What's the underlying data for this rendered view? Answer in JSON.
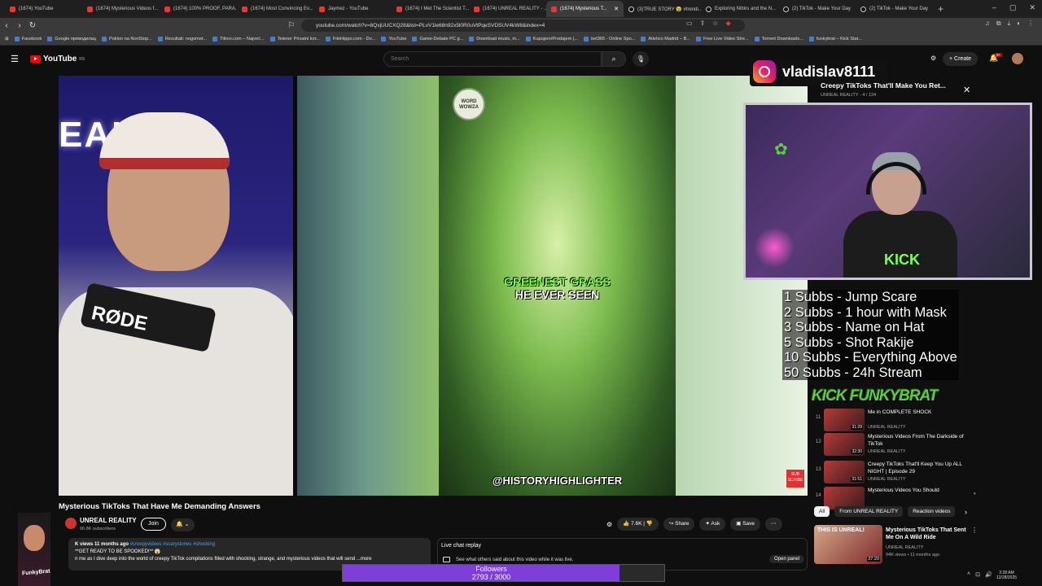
{
  "browser": {
    "tabs": [
      {
        "label": "(1674) YouTube",
        "type": "yt"
      },
      {
        "label": "(1674) Mysterious Videos f...",
        "type": "yt"
      },
      {
        "label": "(1674) 100% PROOF, PARA...",
        "type": "yt"
      },
      {
        "label": "(1674) Most Convincing Ev...",
        "type": "yt"
      },
      {
        "label": "Jaymez - YouTube",
        "type": "yt"
      },
      {
        "label": "(1674) I Met The Scientist T...",
        "type": "yt"
      },
      {
        "label": "(1674) UNREAL REALITY - ...",
        "type": "yt"
      },
      {
        "label": "(1674) Mysterious T...",
        "type": "yt",
        "active": true
      },
      {
        "label": "(3)TRUE STORY 😵 #trendi...",
        "type": "tk"
      },
      {
        "label": "Exploring Nibiru and the N...",
        "type": "tk"
      },
      {
        "label": "(2) TikTok - Make Your Day",
        "type": "tk"
      },
      {
        "label": "(2) TikTok - Make Your Day",
        "type": "tk"
      }
    ],
    "url": "youtube.com/watch?v=8QxjUUCXQ28&list=PLvV1le68n92x5l0R0uVtPqeSVDSUV4kW8&index=4",
    "bookmarks": [
      "Facebook",
      "Google преводилац",
      "Poklon na NonStop...",
      "Rezultati: nogomet...",
      "Titlovi.com – Najveć...",
      "Telenor Privatni kor...",
      "FileHippo.com - Do...",
      "YouTube",
      "Game-Debate PC g...",
      "Download music, m...",
      "Kupujem/Prodajem |...",
      "bet365 - Online Spo...",
      "Atletico Madrid – B...",
      "Free Live Video Stre...",
      "Torrent Downloads...",
      "funkybrat – Kick Stat..."
    ]
  },
  "youtube": {
    "logo_text": "YouTube",
    "logo_region": "RS",
    "search_placeholder": "Search",
    "create_label": "Create",
    "notif_count": "9+"
  },
  "player": {
    "neon_text": "EAL  TY",
    "mic_brand": "RØDE",
    "watermark": "WORD WOWZA",
    "caption_line1": "GREENEST GRASS",
    "caption_line2": "HE EVER SEEN",
    "credit": "@HISTORYHIGHLIGHTER",
    "sub_badge": "SUB SCRIBE"
  },
  "overlay": {
    "instagram_handle": "vladislav8111",
    "miniplayer_title": "Creepy TikToks That'll Make You Ret...",
    "miniplayer_sub": "UNREAL REALITY - 4 / 134",
    "webcam_shirt_text": "KICK",
    "sub_goals": [
      "1 Subbs - Jump Scare",
      "2 Subbs - 1 hour with Mask",
      "3 Subbs - Name on Hat",
      "5 Subbs - Shot Rakije",
      "10 Subbs - Everything Above",
      "50 Subbs - 24h Stream"
    ],
    "kick_logo": "KICK FUNKYBRAT",
    "followers_label": "Followers",
    "followers_value": "2793 / 3000",
    "followers_progress": 0.931,
    "left_book_title": "FunkyBrat"
  },
  "playlist": [
    {
      "index": "11",
      "title": "Me in COMPLETE SHOCK",
      "channel": "UNREAL REALITY",
      "duration": "31:29"
    },
    {
      "index": "12",
      "title": "Mysterious Videos From The Darkside of TikTok",
      "channel": "UNREAL REALITY",
      "duration": "32:30"
    },
    {
      "index": "13",
      "title": "Creepy TikToks That'll Keep You Up ALL NIGHT | Episode 29",
      "channel": "UNREAL REALITY",
      "duration": "31:51"
    },
    {
      "index": "14",
      "title": "Mysterious Videos You Should",
      "channel": "",
      "duration": ""
    }
  ],
  "chips": [
    "All",
    "From UNREAL REALITY",
    "Reaction videos"
  ],
  "recommendation": {
    "title": "Mysterious TikToks That Sent Me On A Wild Ride",
    "channel": "UNREAL REALITY",
    "meta": "94K views • 11 months ago",
    "duration": "37:20",
    "thumb_text": "THIS IS UNREAL!"
  },
  "video": {
    "title": "Mysterious TikToks That Have Me Demanding Answers",
    "channel": "UNREAL REALITY",
    "subscribers": "90.8K subscribers",
    "join_label": "Join",
    "likes": "7.6K",
    "share_label": "Share",
    "ask_label": "Ask",
    "save_label": "Save",
    "desc_views": "K views  11 months ago",
    "desc_tags": "#creepyvideos #scarystories #shocking",
    "desc_line2": "**GET READY TO BE SPOOKED!** 😱",
    "desc_line3": "n me as I dive deep into the world of creepy TikTok compilations filled with shocking, strange, and mysterious videos that will send ...more"
  },
  "live_chat": {
    "title": "Live chat replay",
    "desc": "See what others said about this video while it was live.",
    "open_label": "Open panel"
  },
  "system": {
    "time": "2:28 AM",
    "date": "12/28/2025"
  }
}
